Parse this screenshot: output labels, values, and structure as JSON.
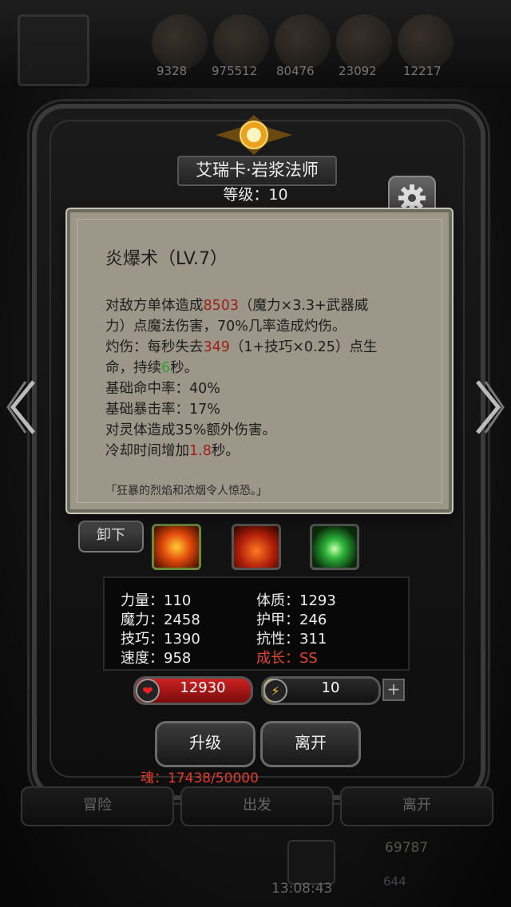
{
  "header": {
    "resources": [
      "9328",
      "975512",
      "80476",
      "23092",
      "12217"
    ]
  },
  "hero": {
    "name": "艾瑞卡·岩浆法师",
    "level": "等级：10"
  },
  "popup": {
    "title": "炎爆术（LV.7）",
    "line1_a": "对敌方单体造成",
    "line1_b": "8503",
    "line1_c": "（魔力×3.3+武器威",
    "line2": "力）点魔法伤害，70%几率造成灼伤。",
    "line3_a": "灼伤：每秒失去",
    "line3_b": "349",
    "line3_c": "（1+技巧×0.25）点生",
    "line4_a": "命，持续",
    "line4_b": "6",
    "line4_c": "秒。",
    "line5": "基础命中率：40%",
    "line6": "基础暴击率：17%",
    "line7": "对灵体造成35%额外伤害。",
    "line8_a": "冷却时间增加",
    "line8_b": "1.8",
    "line8_c": "秒。",
    "quote": "「狂暴的烈焰和浓烟令人惊恐。」"
  },
  "skills": {
    "unequip_label": "卸下"
  },
  "stats": {
    "strength": "力量：110",
    "constitution": "体质：1293",
    "magic": "魔力：2458",
    "armor": "护甲：246",
    "skill": "技巧：1390",
    "resistance": "抗性：311",
    "speed": "速度：958",
    "growth": "成长：SS"
  },
  "bars": {
    "hp": "12930",
    "energy": "10",
    "energy_fill": 0.1
  },
  "buttons": {
    "upgrade": "升级",
    "leave": "离开"
  },
  "soul": "魂：17438/50000",
  "nav": {
    "adventure": "冒险",
    "depart": "出发",
    "leave": "离开"
  },
  "footer": {
    "time": "13:08:43",
    "gold": "69787",
    "gems": "644"
  }
}
